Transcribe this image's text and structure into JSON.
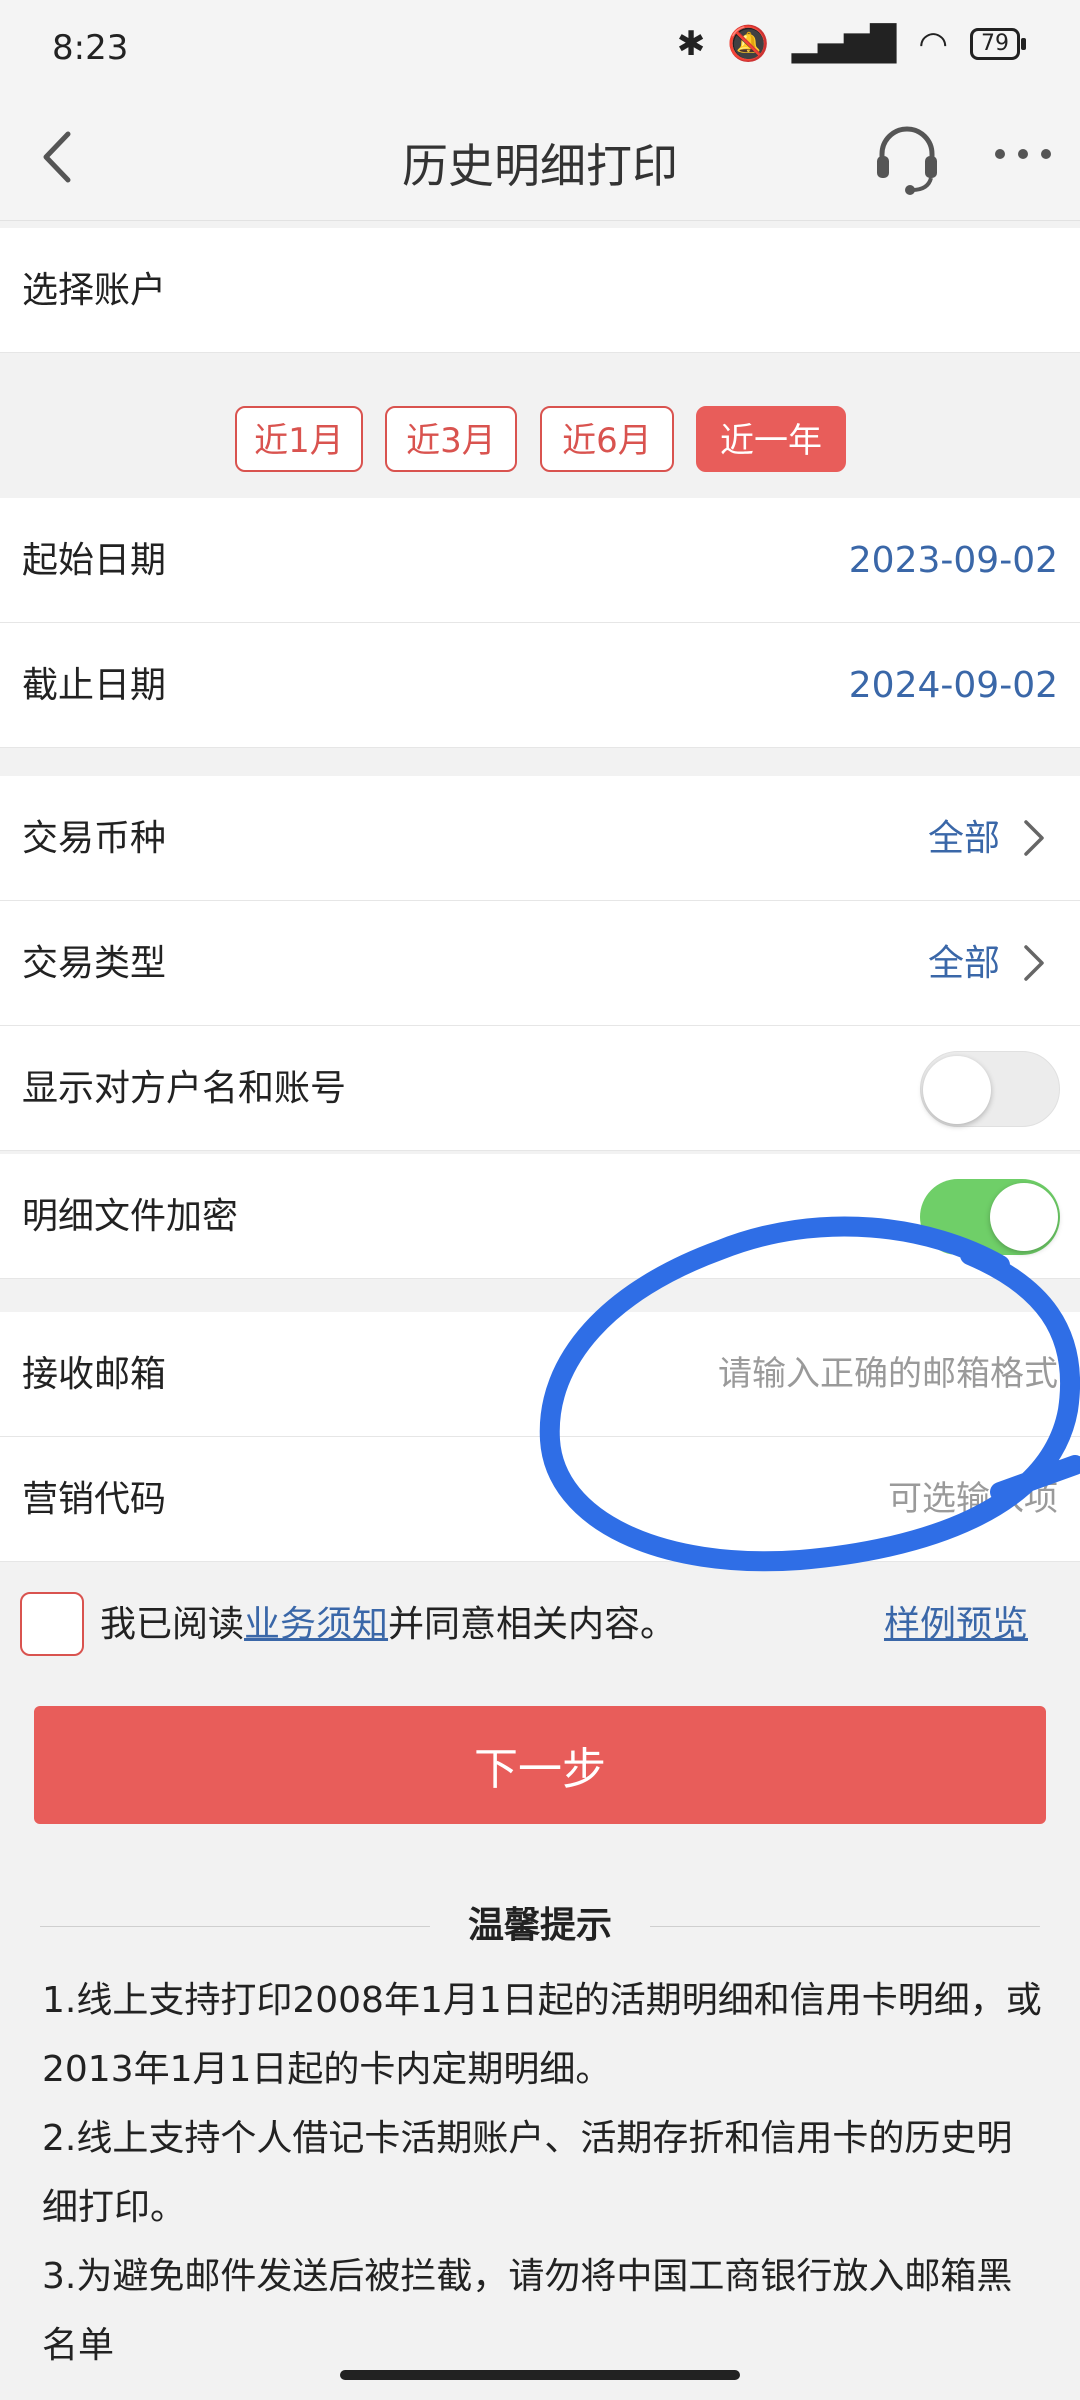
{
  "status_bar": {
    "time": "8:23",
    "battery": "79"
  },
  "header": {
    "title": "历史明细打印"
  },
  "account": {
    "label": "选择账户"
  },
  "periods": [
    {
      "label": "近1月",
      "active": false
    },
    {
      "label": "近3月",
      "active": false
    },
    {
      "label": "近6月",
      "active": false
    },
    {
      "label": "近一年",
      "active": true
    }
  ],
  "dates": {
    "start_label": "起始日期",
    "start_value": "2023-09-02",
    "end_label": "截止日期",
    "end_value": "2024-09-02"
  },
  "currency": {
    "label": "交易币种",
    "value": "全部"
  },
  "tx_type": {
    "label": "交易类型",
    "value": "全部"
  },
  "show_counterparty": {
    "label": "显示对方户名和账号",
    "on": false
  },
  "encrypt": {
    "label": "明细文件加密",
    "on": true
  },
  "email": {
    "label": "接收邮箱",
    "placeholder": "请输入正确的邮箱格式"
  },
  "marketing": {
    "label": "营销代码",
    "placeholder": "可选输入项"
  },
  "agree": {
    "prefix": "我已阅读",
    "link": "业务须知",
    "suffix": "并同意相关内容。",
    "sample": "样例预览"
  },
  "next_button": "下一步",
  "tips": {
    "title": "温馨提示",
    "items": [
      "1.线上支持打印2008年1月1日起的活期明细和信用卡明细，或2013年1月1日起的卡内定期明细。",
      "2.线上支持个人借记卡活期账户、活期存折和信用卡的历史明细打印。",
      "3.为避免邮件发送后被拦截，请勿将中国工商银行放入邮箱黑名单"
    ]
  },
  "colors": {
    "accent": "#e85d5a",
    "link": "#3a67a8",
    "toggle_on": "#6fcf68",
    "scribble": "#2f6ee6"
  }
}
